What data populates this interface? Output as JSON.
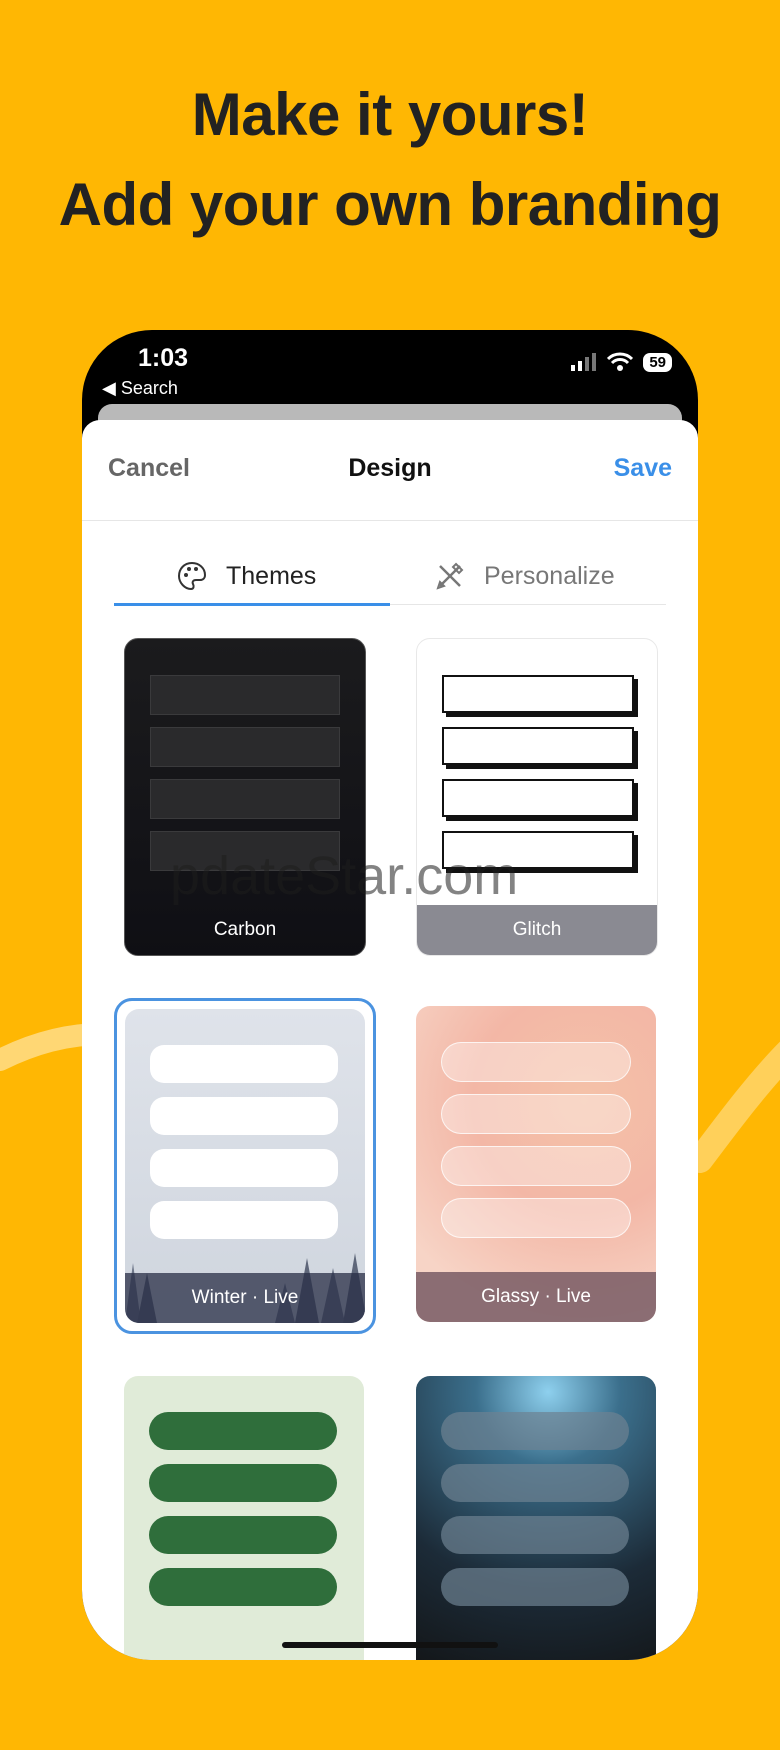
{
  "headline": {
    "line1": "Make it yours!",
    "line2": "Add your own branding"
  },
  "status_bar": {
    "time": "1:03",
    "back_label": "◀ Search",
    "battery": "59"
  },
  "nav": {
    "cancel_label": "Cancel",
    "title": "Design",
    "save_label": "Save"
  },
  "tabs": [
    {
      "label": "Themes",
      "icon": "palette-icon",
      "selected": true
    },
    {
      "label": "Personalize",
      "icon": "tools-icon",
      "selected": false
    }
  ],
  "themes": [
    {
      "label": "Carbon"
    },
    {
      "label": "Glitch"
    },
    {
      "label": "Winter · Live",
      "selected": true
    },
    {
      "label": "Glassy · Live"
    },
    {
      "label": ""
    },
    {
      "label": ""
    }
  ],
  "watermark": "pdateStar.com",
  "colors": {
    "background": "#FFB703",
    "accent": "#3a8fe8",
    "text": "#222222"
  }
}
